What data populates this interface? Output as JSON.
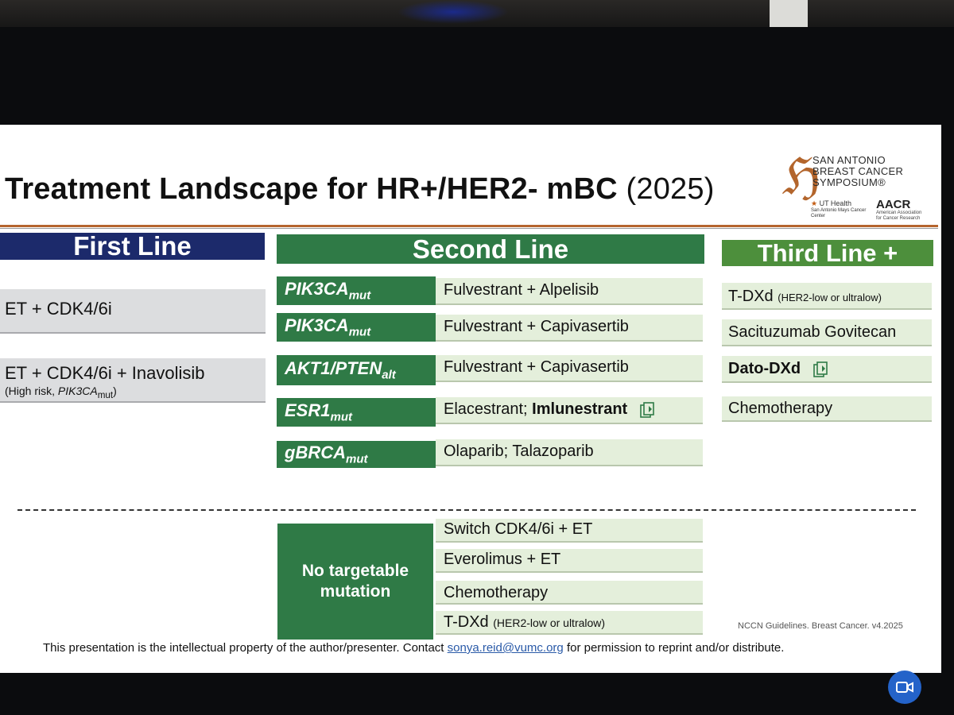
{
  "slide": {
    "title": "Treatment Landscape for HR+/HER2- mBC",
    "title_year": "(2025)",
    "logo": {
      "org_line1": "SAN ANTONIO",
      "org_line2": "BREAST CANCER",
      "org_line3": "SYMPOSIUM®",
      "partner1": "UT Health",
      "partner1_sub": "San Antonio Mays Cancer Center",
      "partner2": "AACR",
      "partner2_sub": "American Association for Cancer Research"
    },
    "columns": {
      "first": "First Line",
      "second": "Second Line",
      "third": "Third Line +"
    },
    "first_line": [
      {
        "label": "ET + CDK4/6i"
      },
      {
        "label": "ET + CDK4/6i + Inavolisib",
        "note_prefix": "(High risk, ",
        "note_italic": "PIK3CA",
        "note_sub": "mut",
        "note_suffix": ")"
      }
    ],
    "second_line": [
      {
        "marker": "PIK3CA",
        "marker_sub": "mut",
        "therapy": "Fulvestrant + Alpelisib"
      },
      {
        "marker": "PIK3CA",
        "marker_sub": "mut",
        "therapy": "Fulvestrant + Capivasertib"
      },
      {
        "marker": "AKT1/PTEN",
        "marker_sub": "alt",
        "therapy": "Fulvestrant + Capivasertib"
      },
      {
        "marker": "ESR1",
        "marker_sub": "mut",
        "therapy": "Elacestrant; ",
        "therapy_bold": "Imlunestrant",
        "icon": "new-document-icon"
      },
      {
        "marker": "gBRCA",
        "marker_sub": "mut",
        "therapy": "Olaparib; Talazoparib"
      }
    ],
    "third_line": [
      {
        "label": "T-DXd",
        "small": "(HER2-low or ultralow)"
      },
      {
        "label": "Sacituzumab Govitecan"
      },
      {
        "label": "Dato-DXd",
        "icon": "new-document-icon"
      },
      {
        "label": "Chemotherapy"
      }
    ],
    "no_target": {
      "label": "No targetable mutation",
      "options": [
        {
          "label": "Switch CDK4/6i + ET"
        },
        {
          "label": "Everolimus + ET"
        },
        {
          "label": "Chemotherapy"
        },
        {
          "label": "T-DXd",
          "small": "(HER2-low or ultralow)"
        }
      ]
    },
    "reference": "NCCN Guidelines. Breast Cancer. v4.2025",
    "footer_text": "This presentation is the intellectual property of the author/presenter. Contact",
    "footer_email": "sonya.reid@vumc.org",
    "footer_tail": "for permission to reprint and/or distribute."
  },
  "colors": {
    "first_header": "#1c2a6b",
    "second_header": "#2f7a46",
    "third_header": "#4d8f3c",
    "rule": "#b5652e",
    "cell_green": "#e4efdb",
    "cell_gray": "#dcdddf"
  }
}
